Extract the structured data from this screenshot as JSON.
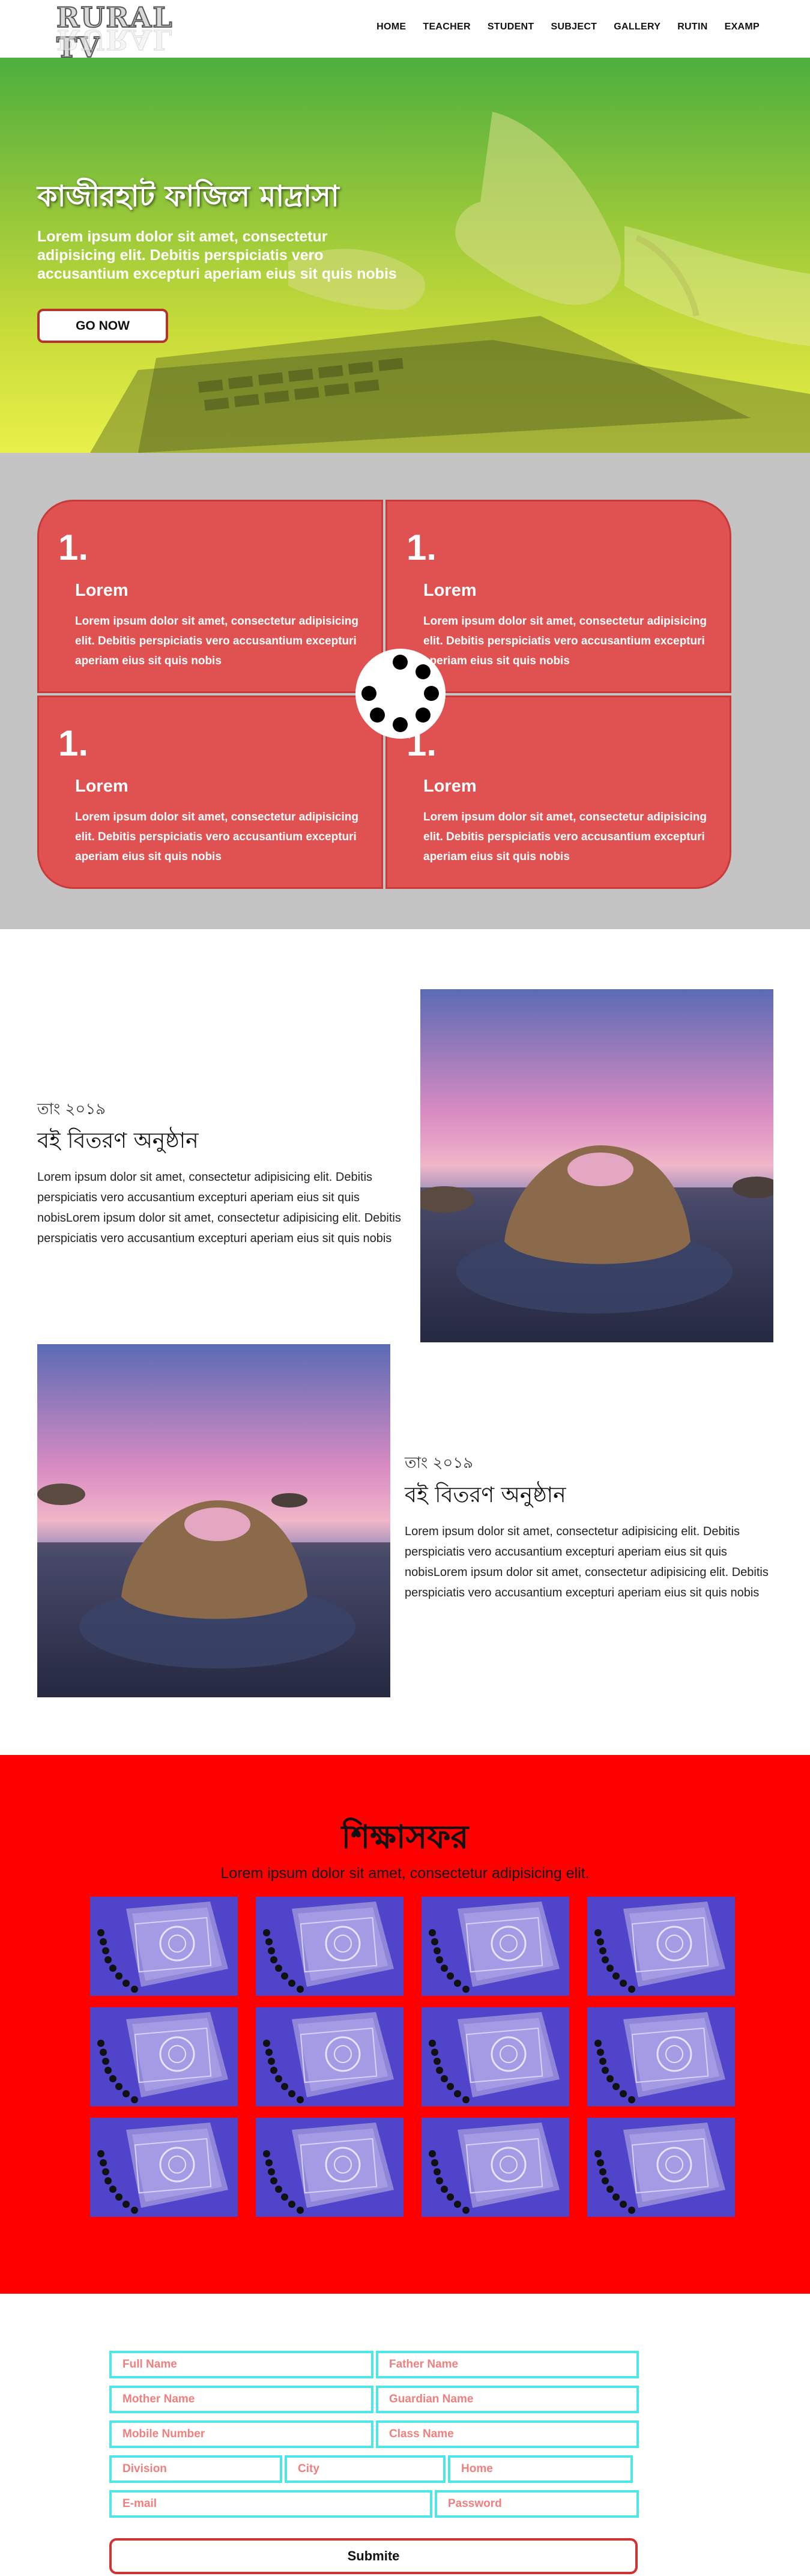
{
  "header": {
    "logo": "RURAL TV",
    "nav": [
      "HOME",
      "TEACHER",
      "STUDENT",
      "SUBJECT",
      "GALLERY",
      "RUTIN",
      "EXAMP"
    ]
  },
  "hero": {
    "title": "কাজীরহাট ফাজিল মাদ্রাসা",
    "text": "Lorem ipsum dolor sit amet, consectetur adipisicing elit. Debitis perspiciatis vero accusantium excepturi aperiam eius sit quis nobis",
    "button": "GO NOW"
  },
  "features": [
    {
      "num": "1.",
      "title": "Lorem",
      "text": "Lorem ipsum dolor sit amet, consectetur adipisicing elit. Debitis perspiciatis vero accusantium excepturi aperiam eius sit quis nobis"
    },
    {
      "num": "1.",
      "title": "Lorem",
      "text": "Lorem ipsum dolor sit amet, consectetur adipisicing elit. Debitis perspiciatis vero accusantium excepturi aperiam eius sit quis nobis"
    },
    {
      "num": "1.",
      "title": "Lorem",
      "text": "Lorem ipsum dolor sit amet, consectetur adipisicing elit. Debitis perspiciatis vero accusantium excepturi aperiam eius sit quis nobis"
    },
    {
      "num": "1.",
      "title": "Lorem",
      "text": "Lorem ipsum dolor sit amet, consectetur adipisicing elit. Debitis perspiciatis vero accusantium excepturi aperiam eius sit quis nobis"
    }
  ],
  "events": [
    {
      "date": "তাং ২০১৯",
      "title": "বই বিতরণ অনুষ্ঠান",
      "text": "Lorem ipsum dolor sit amet, consectetur adipisicing elit. Debitis perspiciatis vero accusantium excepturi aperiam eius sit quis nobisLorem ipsum dolor sit amet, consectetur adipisicing elit. Debitis perspiciatis vero accusantium excepturi aperiam eius sit quis nobis"
    },
    {
      "date": "তাং ২০১৯",
      "title": "বই বিতরণ অনুষ্ঠান",
      "text": "Lorem ipsum dolor sit amet, consectetur adipisicing elit. Debitis perspiciatis vero accusantium excepturi aperiam eius sit quis nobisLorem ipsum dolor sit amet, consectetur adipisicing elit. Debitis perspiciatis vero accusantium excepturi aperiam eius sit quis nobis"
    }
  ],
  "gallery": {
    "title": "শিক্ষাসফর",
    "subtitle": "Lorem ipsum dolor sit amet, consectetur adipisicing elit."
  },
  "form": {
    "full_name": "Full Name",
    "father_name": "Father Name",
    "mother_name": "Mother Name",
    "guardian_name": "Guardian Name",
    "mobile": "Mobile Number",
    "class_name": "Class Name",
    "division": "Division",
    "city": "City",
    "home": "Home",
    "email": "E-mail",
    "password": "Password",
    "submit": "Submite"
  },
  "colors": {
    "feature_red": "#e05252",
    "gallery_bg": "#ff0000",
    "field_border": "#4ee6e6",
    "placeholder": "#f08080"
  }
}
